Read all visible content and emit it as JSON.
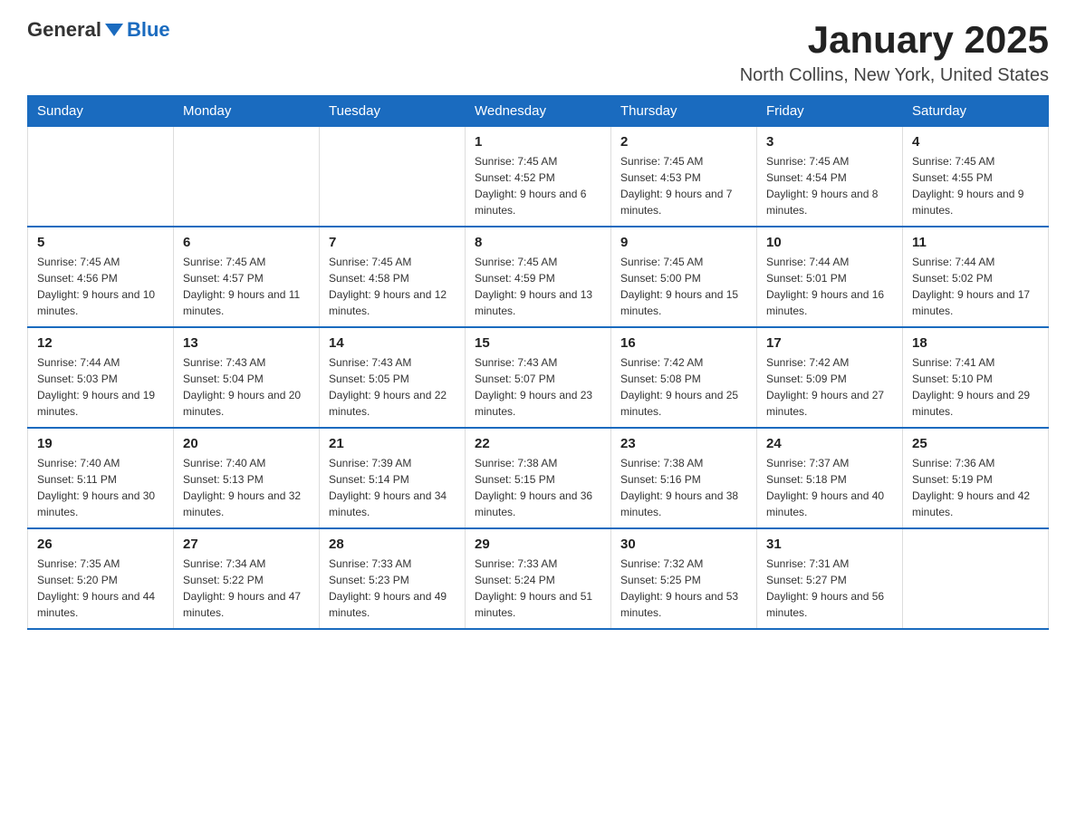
{
  "logo": {
    "general": "General",
    "blue": "Blue"
  },
  "header": {
    "title": "January 2025",
    "subtitle": "North Collins, New York, United States"
  },
  "weekdays": [
    "Sunday",
    "Monday",
    "Tuesday",
    "Wednesday",
    "Thursday",
    "Friday",
    "Saturday"
  ],
  "weeks": [
    [
      {
        "day": null,
        "info": null
      },
      {
        "day": null,
        "info": null
      },
      {
        "day": null,
        "info": null
      },
      {
        "day": "1",
        "info": "Sunrise: 7:45 AM\nSunset: 4:52 PM\nDaylight: 9 hours and 6 minutes."
      },
      {
        "day": "2",
        "info": "Sunrise: 7:45 AM\nSunset: 4:53 PM\nDaylight: 9 hours and 7 minutes."
      },
      {
        "day": "3",
        "info": "Sunrise: 7:45 AM\nSunset: 4:54 PM\nDaylight: 9 hours and 8 minutes."
      },
      {
        "day": "4",
        "info": "Sunrise: 7:45 AM\nSunset: 4:55 PM\nDaylight: 9 hours and 9 minutes."
      }
    ],
    [
      {
        "day": "5",
        "info": "Sunrise: 7:45 AM\nSunset: 4:56 PM\nDaylight: 9 hours and 10 minutes."
      },
      {
        "day": "6",
        "info": "Sunrise: 7:45 AM\nSunset: 4:57 PM\nDaylight: 9 hours and 11 minutes."
      },
      {
        "day": "7",
        "info": "Sunrise: 7:45 AM\nSunset: 4:58 PM\nDaylight: 9 hours and 12 minutes."
      },
      {
        "day": "8",
        "info": "Sunrise: 7:45 AM\nSunset: 4:59 PM\nDaylight: 9 hours and 13 minutes."
      },
      {
        "day": "9",
        "info": "Sunrise: 7:45 AM\nSunset: 5:00 PM\nDaylight: 9 hours and 15 minutes."
      },
      {
        "day": "10",
        "info": "Sunrise: 7:44 AM\nSunset: 5:01 PM\nDaylight: 9 hours and 16 minutes."
      },
      {
        "day": "11",
        "info": "Sunrise: 7:44 AM\nSunset: 5:02 PM\nDaylight: 9 hours and 17 minutes."
      }
    ],
    [
      {
        "day": "12",
        "info": "Sunrise: 7:44 AM\nSunset: 5:03 PM\nDaylight: 9 hours and 19 minutes."
      },
      {
        "day": "13",
        "info": "Sunrise: 7:43 AM\nSunset: 5:04 PM\nDaylight: 9 hours and 20 minutes."
      },
      {
        "day": "14",
        "info": "Sunrise: 7:43 AM\nSunset: 5:05 PM\nDaylight: 9 hours and 22 minutes."
      },
      {
        "day": "15",
        "info": "Sunrise: 7:43 AM\nSunset: 5:07 PM\nDaylight: 9 hours and 23 minutes."
      },
      {
        "day": "16",
        "info": "Sunrise: 7:42 AM\nSunset: 5:08 PM\nDaylight: 9 hours and 25 minutes."
      },
      {
        "day": "17",
        "info": "Sunrise: 7:42 AM\nSunset: 5:09 PM\nDaylight: 9 hours and 27 minutes."
      },
      {
        "day": "18",
        "info": "Sunrise: 7:41 AM\nSunset: 5:10 PM\nDaylight: 9 hours and 29 minutes."
      }
    ],
    [
      {
        "day": "19",
        "info": "Sunrise: 7:40 AM\nSunset: 5:11 PM\nDaylight: 9 hours and 30 minutes."
      },
      {
        "day": "20",
        "info": "Sunrise: 7:40 AM\nSunset: 5:13 PM\nDaylight: 9 hours and 32 minutes."
      },
      {
        "day": "21",
        "info": "Sunrise: 7:39 AM\nSunset: 5:14 PM\nDaylight: 9 hours and 34 minutes."
      },
      {
        "day": "22",
        "info": "Sunrise: 7:38 AM\nSunset: 5:15 PM\nDaylight: 9 hours and 36 minutes."
      },
      {
        "day": "23",
        "info": "Sunrise: 7:38 AM\nSunset: 5:16 PM\nDaylight: 9 hours and 38 minutes."
      },
      {
        "day": "24",
        "info": "Sunrise: 7:37 AM\nSunset: 5:18 PM\nDaylight: 9 hours and 40 minutes."
      },
      {
        "day": "25",
        "info": "Sunrise: 7:36 AM\nSunset: 5:19 PM\nDaylight: 9 hours and 42 minutes."
      }
    ],
    [
      {
        "day": "26",
        "info": "Sunrise: 7:35 AM\nSunset: 5:20 PM\nDaylight: 9 hours and 44 minutes."
      },
      {
        "day": "27",
        "info": "Sunrise: 7:34 AM\nSunset: 5:22 PM\nDaylight: 9 hours and 47 minutes."
      },
      {
        "day": "28",
        "info": "Sunrise: 7:33 AM\nSunset: 5:23 PM\nDaylight: 9 hours and 49 minutes."
      },
      {
        "day": "29",
        "info": "Sunrise: 7:33 AM\nSunset: 5:24 PM\nDaylight: 9 hours and 51 minutes."
      },
      {
        "day": "30",
        "info": "Sunrise: 7:32 AM\nSunset: 5:25 PM\nDaylight: 9 hours and 53 minutes."
      },
      {
        "day": "31",
        "info": "Sunrise: 7:31 AM\nSunset: 5:27 PM\nDaylight: 9 hours and 56 minutes."
      },
      {
        "day": null,
        "info": null
      }
    ]
  ]
}
